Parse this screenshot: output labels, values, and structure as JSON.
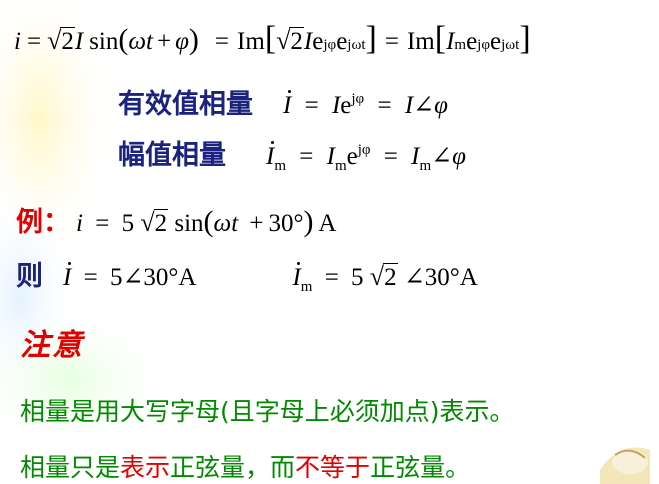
{
  "line1": {
    "i": "i",
    "eq": "=",
    "sqrt2": "2",
    "I": "I",
    "sin": "sin",
    "omega": "ω",
    "t": "t",
    "plus": "+",
    "phi": "φ",
    "eq2": "=",
    "im": "Im",
    "sqrt2b": "2",
    "I2": "I",
    "e": "e",
    "jphi": "jφ",
    "e2": "e",
    "jwt": "jωt",
    "eq3": "=",
    "im2": "Im",
    "Im_I": "I",
    "Im_sub": "m",
    "e3": "e",
    "jphi2": "jφ",
    "e4": "e",
    "jwt2": "jωt"
  },
  "line2": {
    "label": "有效值相量",
    "Idot": "I",
    "eq": "=",
    "I": "I",
    "e": "e",
    "jphi": "jφ",
    "eq2": "=",
    "I2": "I",
    "angle": "∠",
    "phi": "φ"
  },
  "line3": {
    "label": "幅值相量",
    "Idot": "I",
    "sub": "m",
    "eq": "=",
    "I": "I",
    "sub2": "m",
    "e": "e",
    "jphi": "jφ",
    "eq2": "=",
    "I2": "I",
    "sub3": "m",
    "angle": "∠",
    "phi": "φ"
  },
  "example": {
    "label": "例：",
    "i": "i",
    "eq": "=",
    "coef": "5",
    "sqrt2": "2",
    "sin": "sin",
    "omega": "ω",
    "t": "t",
    "plus": "+",
    "deg": "30°",
    "unit": "A"
  },
  "then": {
    "label": "则",
    "Idot": "I",
    "eq": "=",
    "val": "5∠30°A",
    "Im": "I",
    "sub": "m",
    "eq2": "=",
    "coef": "5",
    "sqrt2": "2",
    "val2": "∠30°A"
  },
  "note": {
    "label": "注意"
  },
  "body": {
    "line1": "相量是用大写字母(且字母上必须加点)表示。",
    "line2_a": "相量只是",
    "line2_b": "表示",
    "line2_c": "正弦量，而",
    "line2_d": "不等于",
    "line2_e": "正弦量。"
  }
}
